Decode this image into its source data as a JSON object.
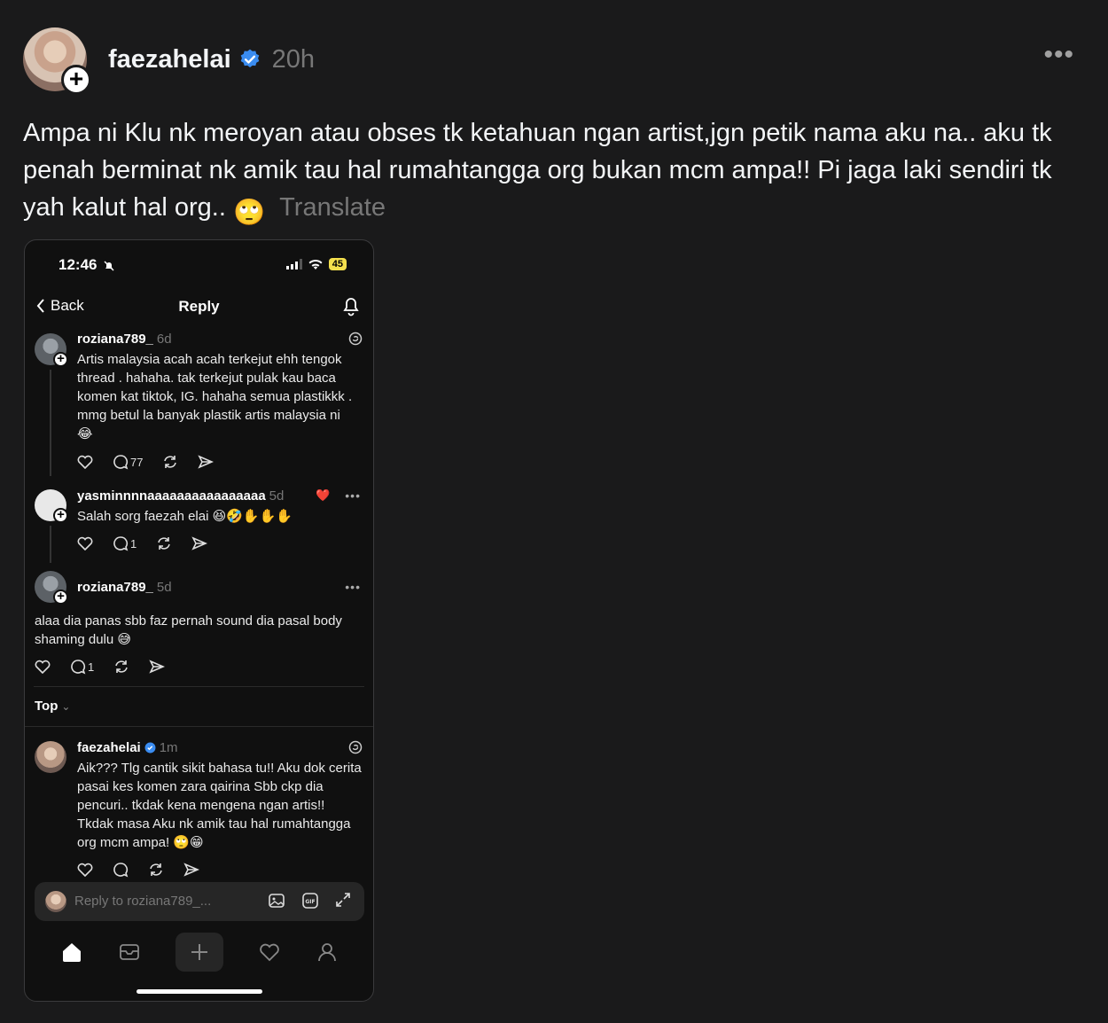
{
  "post": {
    "username": "faezahelai",
    "time": "20h",
    "text": "Ampa ni Klu nk meroyan atau obses tk ketahuan ngan artist,jgn petik nama aku na.. aku tk penah berminat nk amik tau hal rumahtangga org bukan mcm ampa!! Pi jaga laki sendiri tk yah kalut hal org..",
    "emoji": "🙄",
    "translate_label": "Translate"
  },
  "phone": {
    "time": "12:46",
    "battery": "45",
    "back_label": "Back",
    "title": "Reply",
    "comments": [
      {
        "username": "roziana789_",
        "time": "6d",
        "text": "Artis malaysia acah acah terkejut ehh tengok thread . hahaha. tak terkejut pulak kau baca komen kat tiktok, IG. hahaha semua plastikkk . mmg betul la banyak plastik artis malaysia ni",
        "emoji": "😂",
        "reply_count": "77"
      },
      {
        "username": "yasminnnnaaaaaaaaaaaaaaaa",
        "time": "5d",
        "text": "Salah sorg faezah elai",
        "emoji": "😆🤣✋✋✋",
        "reply_count": "1"
      },
      {
        "username": "roziana789_",
        "time": "5d",
        "text": "alaa dia panas sbb faz pernah sound dia pasal body shaming dulu",
        "emoji": "😅",
        "reply_count": "1"
      },
      {
        "username": "faezahelai",
        "time": "1m",
        "text": "Aik??? Tlg cantik sikit bahasa tu!! Aku dok cerita pasai kes komen zara qairina Sbb ckp dia pencuri.. tkdak kena mengena ngan artis!! Tkdak masa Aku nk amik tau hal rumahtangga org mcm ampa!",
        "emoji": "🙄😁"
      }
    ],
    "sort_label": "Top",
    "sort_chevron": "⌄",
    "reply_placeholder": "Reply to roziana789_..."
  },
  "icons": {
    "more": "more-horizontal-icon",
    "verified": "verified-badge-icon",
    "threads": "threads-logo-icon",
    "home": "home-icon",
    "inbox": "inbox-icon",
    "create": "plus-icon",
    "activity": "heart-icon",
    "profile": "person-icon"
  },
  "colors": {
    "background": "#1a1a1b",
    "verified": "#3a8cf0",
    "muted": "#777777",
    "battery": "#f4e04d"
  }
}
